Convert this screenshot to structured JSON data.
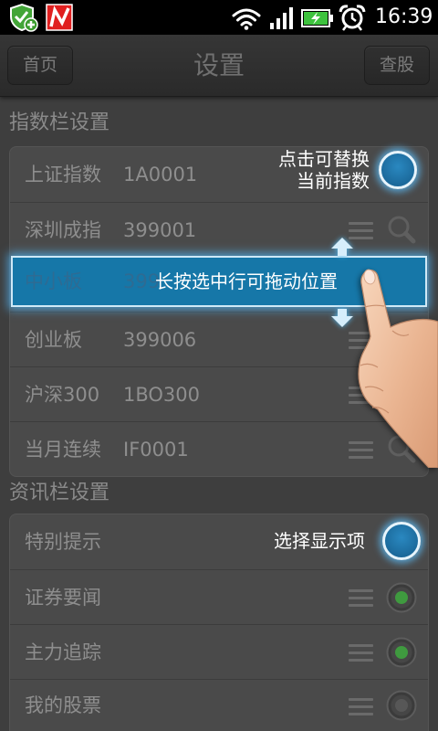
{
  "status_bar": {
    "time": "16:39",
    "left_icons": [
      "shield-plus-icon",
      "stock-app-icon"
    ],
    "right_icons": [
      "wifi-icon",
      "signal-icon",
      "battery-charging-icon",
      "alarm-clock-icon"
    ]
  },
  "header": {
    "left_button": "首页",
    "title": "设置",
    "right_button": "查股"
  },
  "index_section": {
    "title": "指数栏设置",
    "rows": [
      {
        "name": "上证指数",
        "code": "1A0001"
      },
      {
        "name": "深圳成指",
        "code": "399001"
      },
      {
        "name": "中小板",
        "code": "399"
      },
      {
        "name": "创业板",
        "code": "399006"
      },
      {
        "name": "沪深300",
        "code": "1BO300"
      },
      {
        "name": "当月连续",
        "code": "IF0001"
      }
    ]
  },
  "news_section": {
    "title": "资讯栏设置",
    "rows": [
      {
        "name": "特别提示"
      },
      {
        "name": "证券要闻",
        "selected": true
      },
      {
        "name": "主力追踪",
        "selected": true
      },
      {
        "name": "我的股票",
        "selected": false
      }
    ]
  },
  "guide": {
    "replace_tip": [
      "点击可替换",
      "当前指数"
    ],
    "drag_tip": "长按选中行可拖动位置",
    "select_tip": "选择显示项"
  },
  "colors": {
    "guide_blue": "#1677a8",
    "radio_selected": "#3f9a3f",
    "radio_unselected": "#575757",
    "battery_green": "#3ec23e"
  }
}
